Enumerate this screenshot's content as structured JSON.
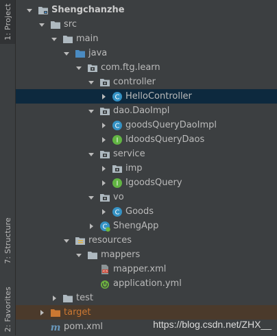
{
  "side_tabs": {
    "project": "1: Project",
    "structure": "7: Structure",
    "favorites": "2: Favorites"
  },
  "tree": [
    {
      "label": "Shengchanzhe",
      "icon": "module-folder-icon",
      "expanded": true,
      "bold": true
    },
    {
      "label": "src",
      "icon": "folder-icon",
      "expanded": true
    },
    {
      "label": "main",
      "icon": "folder-icon",
      "expanded": true
    },
    {
      "label": "java",
      "icon": "source-folder-icon",
      "expanded": true
    },
    {
      "label": "com.ftg.learn",
      "icon": "package-icon",
      "expanded": true
    },
    {
      "label": "controller",
      "icon": "package-icon",
      "expanded": true
    },
    {
      "label": "HelloController",
      "icon": "class-icon",
      "expanded": false,
      "selected": true
    },
    {
      "label": "dao.DaoImpl",
      "icon": "package-icon",
      "expanded": true
    },
    {
      "label": "goodsQueryDaoImpl",
      "icon": "class-icon",
      "expanded": false
    },
    {
      "label": "IdoodsQueryDaos",
      "icon": "interface-icon",
      "expanded": false
    },
    {
      "label": "service",
      "icon": "package-icon",
      "expanded": true
    },
    {
      "label": "imp",
      "icon": "package-icon",
      "expanded": false
    },
    {
      "label": "IgoodsQuery",
      "icon": "interface-icon",
      "expanded": false
    },
    {
      "label": "vo",
      "icon": "package-icon",
      "expanded": true
    },
    {
      "label": "Goods",
      "icon": "class-icon",
      "expanded": false
    },
    {
      "label": "ShengApp",
      "icon": "spring-boot-class-icon",
      "expanded": false
    },
    {
      "label": "resources",
      "icon": "resources-folder-icon",
      "expanded": true
    },
    {
      "label": "mappers",
      "icon": "folder-icon",
      "expanded": true
    },
    {
      "label": "mapper.xml",
      "icon": "xml-file-icon"
    },
    {
      "label": "application.yml",
      "icon": "yml-file-icon"
    },
    {
      "label": "test",
      "icon": "folder-icon",
      "expanded": false
    },
    {
      "label": "target",
      "icon": "excluded-folder-icon",
      "expanded": false,
      "highlight": "target"
    },
    {
      "label": "pom.xml",
      "icon": "maven-icon"
    }
  ],
  "watermark": "https://blog.csdn.net/ZHX__",
  "colors": {
    "background": "#3c3f41",
    "selection": "#0d293e",
    "class_icon": "#3592c4",
    "interface_icon": "#62b543",
    "folder": "#aeb9c0",
    "source_folder": "#4a8bc2",
    "target_folder": "#cc7832"
  }
}
